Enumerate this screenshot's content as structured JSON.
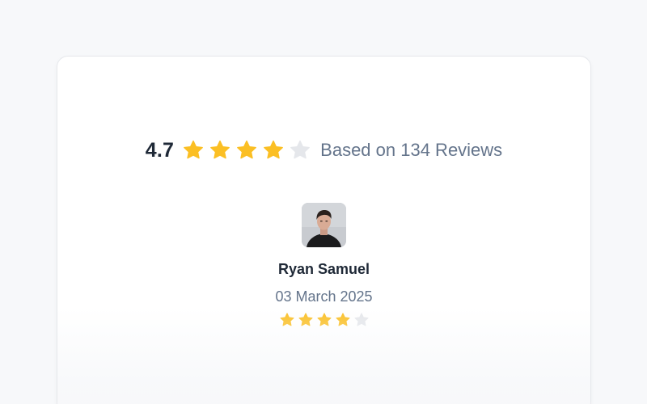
{
  "summary": {
    "average_rating": "4.7",
    "rating_out_of_5": 4,
    "based_on_text": "Based on 134 Reviews"
  },
  "review": {
    "reviewer_name": "Ryan Samuel",
    "date": "03 March 2025",
    "rating_out_of_5": 4,
    "avatar_icon": "avatar-photo"
  },
  "colors": {
    "star_filled": "#fbbf24",
    "star_empty": "#e5e7eb",
    "text_primary": "#1f2937",
    "text_muted": "#64748b"
  }
}
